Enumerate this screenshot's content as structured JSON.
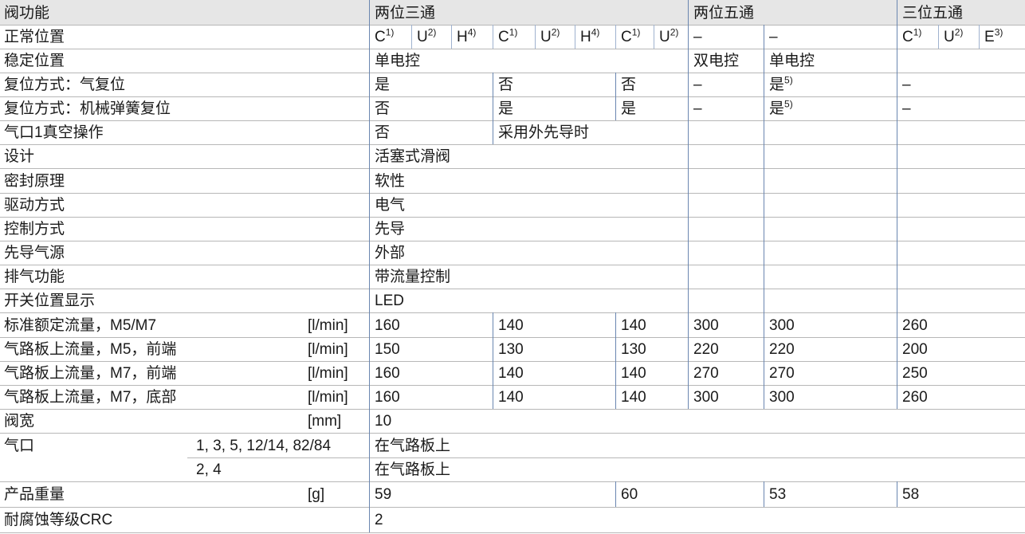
{
  "rows": [
    {
      "label": "阀功能",
      "header": true,
      "cells": [
        {
          "text": "两位三通",
          "col": 1
        },
        {
          "text": "两位五通",
          "col": 10
        },
        {
          "text": "三位五通",
          "col": 12
        }
      ]
    },
    {
      "label": "正常位置",
      "cells": [
        {
          "text": "C",
          "sup": "1)",
          "col": 1
        },
        {
          "text": "U",
          "sup": "2)",
          "col": 2
        },
        {
          "text": "H",
          "sup": "4)",
          "col": 3
        },
        {
          "text": "C",
          "sup": "1)",
          "col": 4
        },
        {
          "text": "U",
          "sup": "2)",
          "col": 5
        },
        {
          "text": "H",
          "sup": "4)",
          "col": 6
        },
        {
          "text": "C",
          "sup": "1)",
          "col": 7
        },
        {
          "text": "U",
          "sup": "2)",
          "col": 8
        },
        {
          "text": "–",
          "col": 10
        },
        {
          "text": "–",
          "col": 11
        },
        {
          "text": "C",
          "sup": "1)",
          "col": 12
        },
        {
          "text": "U",
          "sup": "2)",
          "col": 13
        },
        {
          "text": "E",
          "sup": "3)",
          "col": 14
        }
      ]
    },
    {
      "label": "稳定位置",
      "cells": [
        {
          "text": "单电控",
          "col": 1
        },
        {
          "text": "双电控",
          "col": 10
        },
        {
          "text": "单电控",
          "col": 11
        }
      ]
    },
    {
      "label": "复位方式：气复位",
      "cells": [
        {
          "text": "是",
          "col": 1
        },
        {
          "text": "否",
          "col": 4
        },
        {
          "text": "否",
          "col": 7
        },
        {
          "text": "–",
          "col": 10
        },
        {
          "text": "是",
          "sup": "5)",
          "col": 11
        },
        {
          "text": "–",
          "col": 12
        }
      ]
    },
    {
      "label": "复位方式：机械弹簧复位",
      "cells": [
        {
          "text": "否",
          "col": 1
        },
        {
          "text": "是",
          "col": 4
        },
        {
          "text": "是",
          "col": 7
        },
        {
          "text": "–",
          "col": 10
        },
        {
          "text": "是",
          "sup": "5)",
          "col": 11
        },
        {
          "text": "–",
          "col": 12
        }
      ]
    },
    {
      "label": "气口1真空操作",
      "cells": [
        {
          "text": "否",
          "col": 1
        },
        {
          "text": "采用外先导时",
          "col": 4
        }
      ]
    },
    {
      "label": "设计",
      "cells": [
        {
          "text": "活塞式滑阀",
          "col": 1
        }
      ]
    },
    {
      "label": "密封原理",
      "cells": [
        {
          "text": "软性",
          "col": 1
        }
      ]
    },
    {
      "label": "驱动方式",
      "cells": [
        {
          "text": "电气",
          "col": 1
        }
      ]
    },
    {
      "label": "控制方式",
      "cells": [
        {
          "text": "先导",
          "col": 1
        }
      ]
    },
    {
      "label": "先导气源",
      "cells": [
        {
          "text": "外部",
          "col": 1
        }
      ]
    },
    {
      "label": "排气功能",
      "cells": [
        {
          "text": "带流量控制",
          "col": 1
        }
      ]
    },
    {
      "label": "开关位置显示",
      "cells": [
        {
          "text": "LED",
          "col": 1
        }
      ]
    },
    {
      "label": "标准额定流量，M5/M7",
      "unit": "[l/min]",
      "cells": [
        {
          "text": "160",
          "col": 1
        },
        {
          "text": "140",
          "col": 4
        },
        {
          "text": "140",
          "col": 7
        },
        {
          "text": "300",
          "col": 10
        },
        {
          "text": "300",
          "col": 11
        },
        {
          "text": "260",
          "col": 12
        }
      ]
    },
    {
      "label": "气路板上流量，M5，前端",
      "unit": "[l/min]",
      "cells": [
        {
          "text": "150",
          "col": 1
        },
        {
          "text": "130",
          "col": 4
        },
        {
          "text": "130",
          "col": 7
        },
        {
          "text": "220",
          "col": 10
        },
        {
          "text": "220",
          "col": 11
        },
        {
          "text": "200",
          "col": 12
        }
      ]
    },
    {
      "label": "气路板上流量，M7，前端",
      "unit": "[l/min]",
      "cells": [
        {
          "text": "160",
          "col": 1
        },
        {
          "text": "140",
          "col": 4
        },
        {
          "text": "140",
          "col": 7
        },
        {
          "text": "270",
          "col": 10
        },
        {
          "text": "270",
          "col": 11
        },
        {
          "text": "250",
          "col": 12
        }
      ]
    },
    {
      "label": "气路板上流量，M7，底部",
      "unit": "[l/min]",
      "cells": [
        {
          "text": "160",
          "col": 1
        },
        {
          "text": "140",
          "col": 4
        },
        {
          "text": "140",
          "col": 7
        },
        {
          "text": "300",
          "col": 10
        },
        {
          "text": "300",
          "col": 11
        },
        {
          "text": "260",
          "col": 12
        }
      ]
    },
    {
      "label": "阀宽",
      "unit": "[mm]",
      "cells": [
        {
          "text": "10",
          "col": 1
        }
      ]
    },
    {
      "label": "气口",
      "sublabel": "1, 3, 5, 12/14, 82/84",
      "cells": [
        {
          "text": "在气路板上",
          "col": 1
        }
      ]
    },
    {
      "label": "",
      "sublabel": "2, 4",
      "cells": [
        {
          "text": "在气路板上",
          "col": 1
        }
      ]
    },
    {
      "label": "产品重量",
      "unit": "[g]",
      "cells": [
        {
          "text": "59",
          "col": 1
        },
        {
          "text": "60",
          "col": 7
        },
        {
          "text": "53",
          "col": 11
        },
        {
          "text": "58",
          "col": 12
        }
      ]
    },
    {
      "label": "耐腐蚀等级CRC",
      "cells": [
        {
          "text": "2",
          "col": 1
        }
      ]
    }
  ]
}
